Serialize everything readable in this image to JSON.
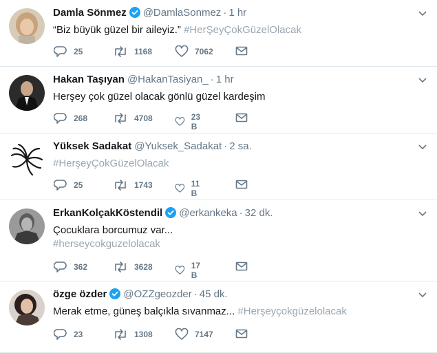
{
  "tweets": [
    {
      "name": "Damla Sönmez",
      "verified": true,
      "handle": "@DamlaSonmez",
      "time": "1 hr",
      "text": "“Biz büyük güzel bir aileyiz.”",
      "hashtag": "#HerŞeyÇokGüzelOlacak",
      "replies": "25",
      "retweets": "1168",
      "likes": "7062",
      "avatar": "woman-light-hair"
    },
    {
      "name": "Hakan Taşıyan",
      "verified": false,
      "handle": "@HakanTasiyan_",
      "time": "1 hr",
      "text": "Herşey  çok güzel olacak gönlü güzel kardeşim",
      "hashtag": "",
      "replies": "268",
      "retweets": "4708",
      "likes": "23 B",
      "avatar": "man-suit"
    },
    {
      "name": "Yüksek Sadakat",
      "verified": false,
      "handle": "@Yuksek_Sadakat",
      "time": "2 sa.",
      "text": "",
      "hashtag": "#HerşeyÇokGüzelOlacak",
      "replies": "25",
      "retweets": "1743",
      "likes": "11 B",
      "avatar": "swirl-logo"
    },
    {
      "name": "ErkanKolçakKöstendil",
      "verified": true,
      "handle": "@erkankeka",
      "time": "32 dk.",
      "text": "Çocuklara borcumuz var...",
      "hashtag": "#herseycokguzelolacak",
      "replies": "362",
      "retweets": "3628",
      "likes": "17 B",
      "avatar": "man-bw"
    },
    {
      "name": "özge özder",
      "verified": true,
      "handle": "@OZZgeozder",
      "time": "45 dk.",
      "text": "Merak etme, güneş balçıkla sıvanmaz...",
      "hashtag": "#Herşeyçokgüzelolacak",
      "replies": "23",
      "retweets": "1308",
      "likes": "7147",
      "avatar": "woman-dark-hair"
    }
  ],
  "colors": {
    "verified": "#1da1f2",
    "muted": "#657786",
    "hashtag": "#9aa6b0",
    "divider": "#e1e8ed"
  }
}
